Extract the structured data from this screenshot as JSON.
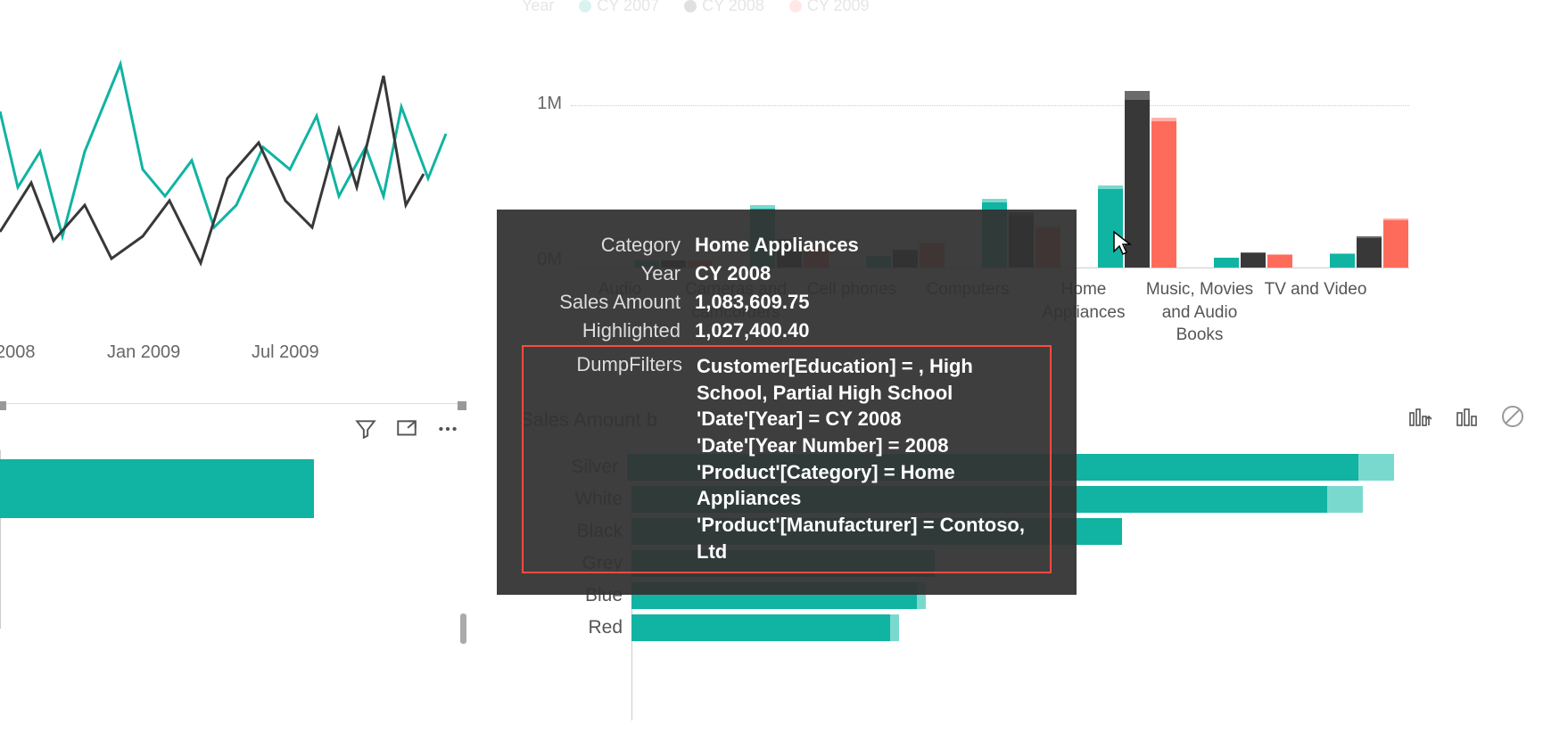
{
  "colors": {
    "teal": "#11b3a2",
    "teal_light": "#7ad9cf",
    "dark": "#383838",
    "red": "#ff6b5b"
  },
  "legend": {
    "label": "Year",
    "items": [
      {
        "name": "CY 2007",
        "color": "#11b3a2"
      },
      {
        "name": "CY 2008",
        "color": "#383838"
      },
      {
        "name": "CY 2009",
        "color": "#ff6b5b"
      }
    ]
  },
  "line_chart_x_labels": [
    "2008",
    "Jan 2009",
    "Jul 2009"
  ],
  "bar_y_ticks": [
    "1M",
    "0M"
  ],
  "bar_x_labels": [
    "Audio",
    "Cameras and camcorders",
    "Cell phones",
    "Computers",
    "Home Appliances",
    "Music, Movies and Audio Books",
    "TV and Video"
  ],
  "tooltip": {
    "rows": [
      {
        "label": "Category",
        "value": "Home Appliances"
      },
      {
        "label": "Year",
        "value": "CY 2008"
      },
      {
        "label": "Sales Amount",
        "value": "1,083,609.75"
      },
      {
        "label": "Highlighted",
        "value": "1,027,400.40"
      }
    ],
    "dump_label": "DumpFilters",
    "dump_lines": [
      "Customer[Education] = , High School, Partial High School",
      "'Date'[Year] = CY 2008",
      "'Date'[Year Number] = 2008",
      "'Product'[Category] = Home Appliances",
      "'Product'[Manufacturer] = Contoso, Ltd"
    ]
  },
  "hbar_title_prefix": "Sales Amount b",
  "hbar_rows": [
    "Silver",
    "White",
    "Black",
    "Grey",
    "Blue",
    "Red"
  ],
  "chart_data": [
    {
      "type": "line",
      "title": "",
      "x_tick_labels": [
        "2008",
        "Jan 2009",
        "Jul 2009"
      ],
      "series": [
        {
          "name": "CY 2007",
          "color": "#11b3a2"
        },
        {
          "name": "CY 2008",
          "color": "#383838"
        }
      ],
      "note": "y-axis not visible in crop; values are relative heights only"
    },
    {
      "type": "bar",
      "grouped": true,
      "ylabel": "",
      "ylim": [
        0,
        1100000
      ],
      "y_ticks": [
        0,
        1000000
      ],
      "categories": [
        "Audio",
        "Cameras and camcorders",
        "Cell phones",
        "Computers",
        "Home Appliances",
        "Music, Movies and Audio Books",
        "TV and Video"
      ],
      "series": [
        {
          "name": "CY 2007",
          "color": "#11b3a2",
          "values": [
            40000,
            380000,
            70000,
            420000,
            500000,
            60000,
            90000
          ],
          "highlighted": [
            40000,
            360000,
            70000,
            400000,
            480000,
            60000,
            85000
          ]
        },
        {
          "name": "CY 2008",
          "color": "#383838",
          "values": [
            40000,
            170000,
            110000,
            340000,
            1083610,
            90000,
            190000
          ],
          "highlighted": [
            40000,
            160000,
            105000,
            320000,
            1027400,
            85000,
            180000
          ]
        },
        {
          "name": "CY 2009",
          "color": "#ff6b5b",
          "values": [
            40000,
            120000,
            150000,
            250000,
            920000,
            80000,
            300000
          ],
          "highlighted": [
            40000,
            115000,
            145000,
            240000,
            900000,
            78000,
            290000
          ]
        }
      ]
    },
    {
      "type": "bar",
      "orientation": "horizontal",
      "title_fragment": "Sales Amount b",
      "categories": [
        "Silver",
        "White",
        "Black",
        "Grey",
        "Blue",
        "Red"
      ],
      "values_full": [
        860,
        780,
        550,
        340,
        320,
        290
      ],
      "values_light_extension": [
        40,
        40,
        0,
        0,
        10,
        10
      ],
      "note": "axis not visible in crop; values are relative bar lengths in px"
    }
  ]
}
